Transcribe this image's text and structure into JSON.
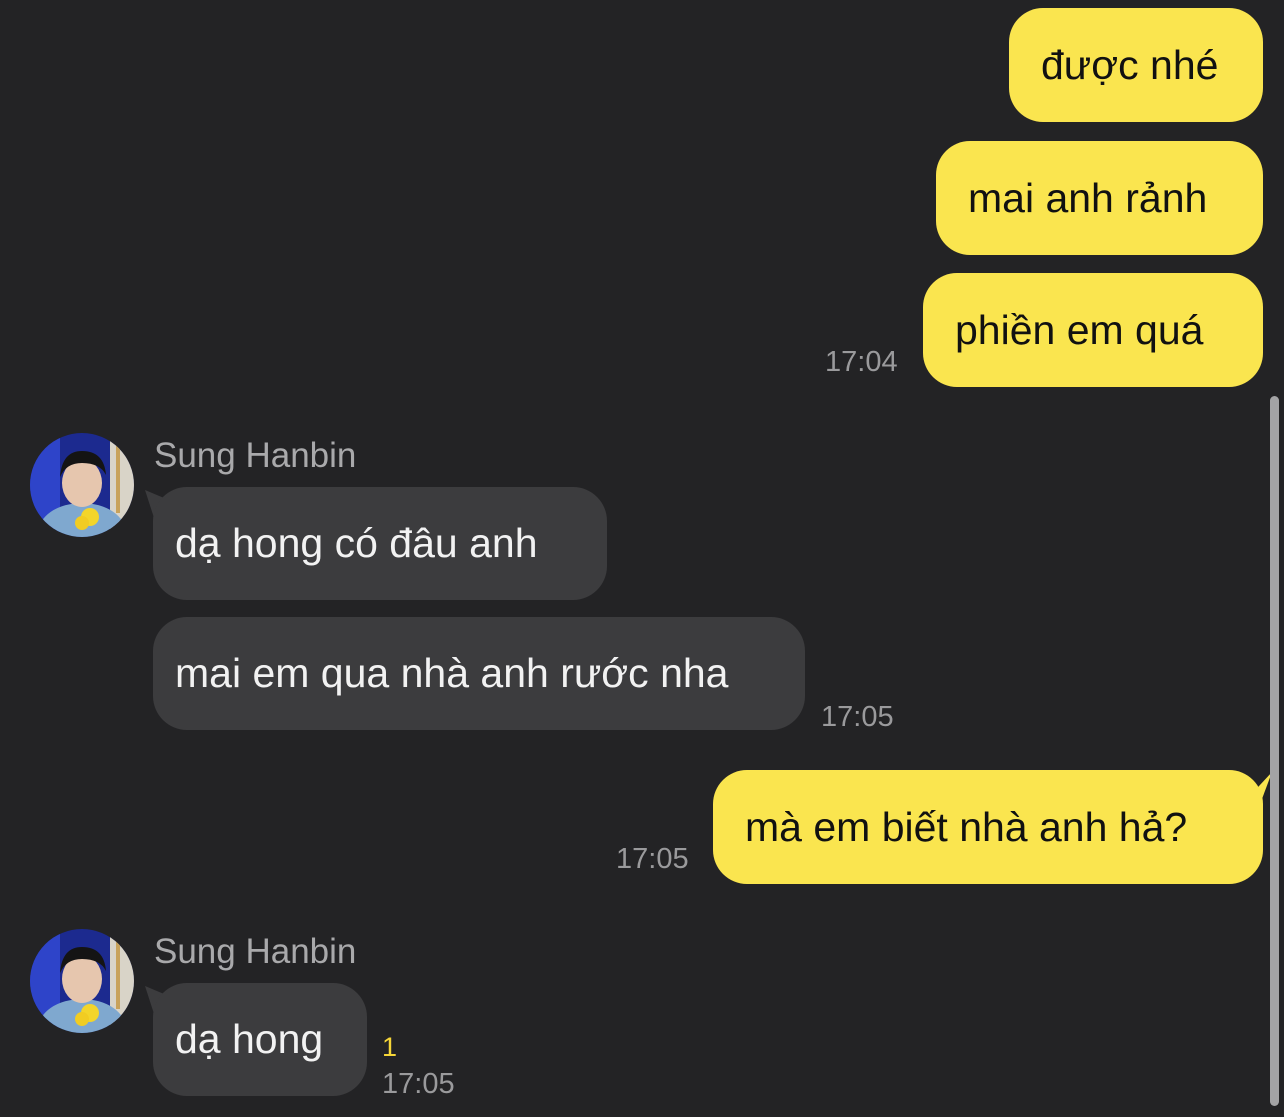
{
  "chat": {
    "contact_name": "Sung Hanbin",
    "messages": [
      {
        "direction": "outgoing",
        "text": "được nhé"
      },
      {
        "direction": "outgoing",
        "text": "mai anh rảnh"
      },
      {
        "direction": "outgoing",
        "text": "phiền em quá",
        "time": "17:04"
      },
      {
        "direction": "incoming",
        "sender": "Sung Hanbin",
        "text": "dạ hong có đâu anh"
      },
      {
        "direction": "incoming",
        "text": "mai em qua nhà anh rước nha",
        "time": "17:05"
      },
      {
        "direction": "outgoing",
        "text": "mà em biết nhà anh hả?",
        "time": "17:05"
      },
      {
        "direction": "incoming",
        "sender": "Sung Hanbin",
        "text": "dạ hong",
        "time": "17:05",
        "unread_count": "1"
      }
    ]
  },
  "colors": {
    "background": "#232325",
    "outgoing_bubble": "#fae54f",
    "incoming_bubble": "#3c3c3e",
    "unread_badge": "#f6d638"
  },
  "icons": {
    "avatar": "profile-photo-avatar"
  }
}
